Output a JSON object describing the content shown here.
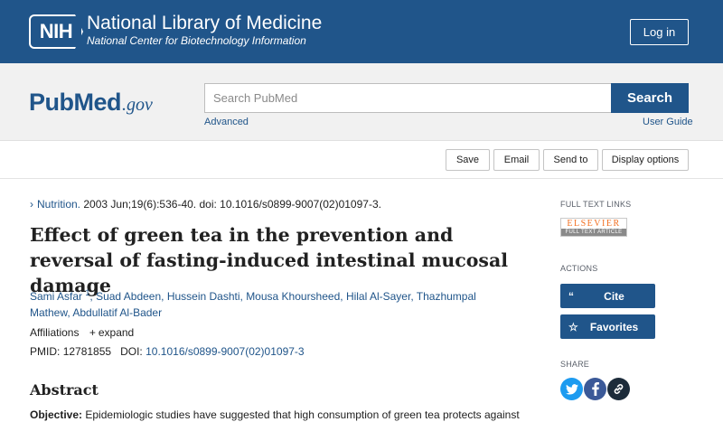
{
  "header": {
    "logo_text": "NIH",
    "title": "National Library of Medicine",
    "subtitle": "National Center for Biotechnology Information",
    "login_label": "Log in"
  },
  "search": {
    "logo_pub": "Pub",
    "logo_med": "Med",
    "logo_gov": ".gov",
    "placeholder": "Search PubMed",
    "button_label": "Search",
    "advanced_label": "Advanced",
    "user_guide_label": "User Guide"
  },
  "toolbar": {
    "save": "Save",
    "email": "Email",
    "send_to": "Send to",
    "display_options": "Display options"
  },
  "article": {
    "journal": "Nutrition.",
    "citation": "2003 Jun;19(6):536-40. doi: 10.1016/s0899-9007(02)01097-3.",
    "title": "Effect of green tea in the prevention and reversal of fasting-induced intestinal mucosal damage",
    "authors": [
      "Sami Asfar",
      "Suad Abdeen",
      "Hussein Dashti",
      "Mousa Khoursheed",
      "Hilal Al-Sayer",
      "Thazhumpal Mathew",
      "Abdullatif Al-Bader"
    ],
    "first_author_sup": "1",
    "affiliations_label": "Affiliations",
    "expand_label": "expand",
    "pmid_label": "PMID:",
    "pmid": "12781855",
    "doi_label": "DOI:",
    "doi": "10.1016/s0899-9007(02)01097-3",
    "abstract_heading": "Abstract",
    "objective_label": "Objective:",
    "objective_text": "Epidemiologic studies have suggested that high consumption of green tea protects against"
  },
  "sidebar": {
    "full_text_heading": "FULL TEXT LINKS",
    "elsevier_top": "ELSEVIER",
    "elsevier_bottom": "FULL TEXT ARTICLE",
    "actions_heading": "ACTIONS",
    "cite_label": "Cite",
    "favorites_label": "Favorites",
    "share_heading": "SHARE",
    "share_icons": [
      "twitter-icon",
      "facebook-icon",
      "link-icon"
    ]
  },
  "colors": {
    "brand_blue": "#20558a",
    "band_gray": "#f1f1f1",
    "twitter": "#1d9bf0",
    "facebook": "#3b5998",
    "elsevier_orange": "#f26f21"
  }
}
